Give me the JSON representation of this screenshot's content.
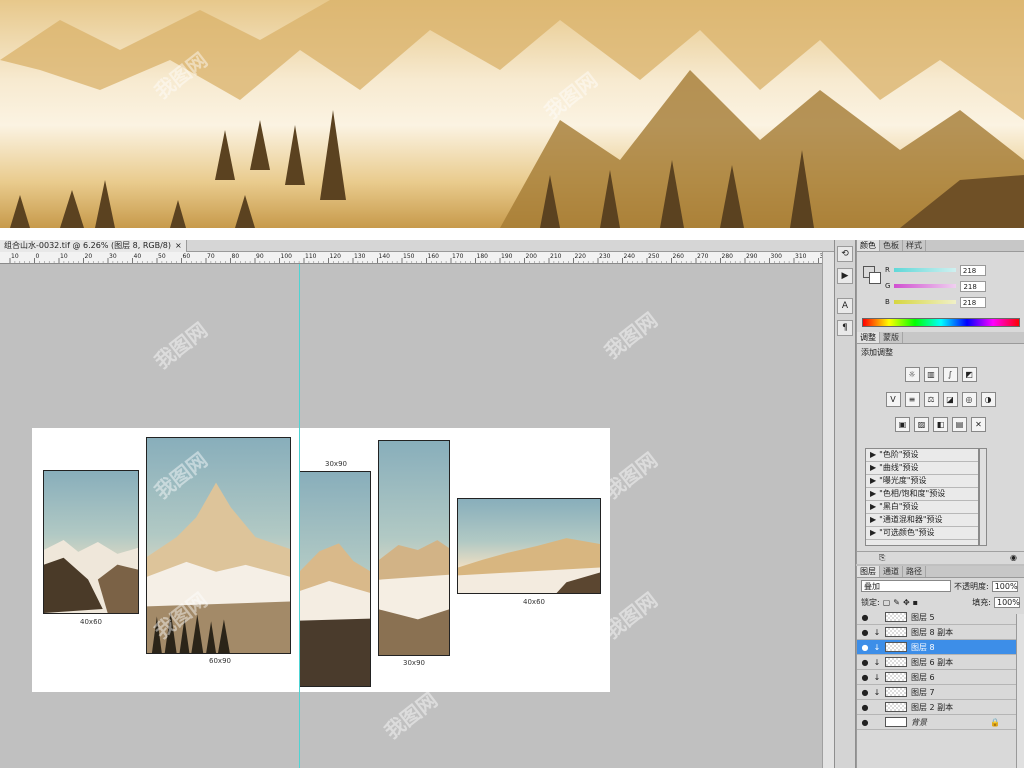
{
  "document": {
    "tab_title": "组合山水-0032.tif @ 6.26% (图层 8, RGB/8)",
    "close_glyph": "×"
  },
  "ruler": {
    "ticks": [
      "10",
      "0",
      "10",
      "20",
      "30",
      "40",
      "50",
      "60",
      "70",
      "80",
      "90",
      "100",
      "110",
      "120",
      "130",
      "140",
      "150",
      "160",
      "170",
      "180",
      "190",
      "200",
      "210",
      "220",
      "230",
      "240",
      "250",
      "260",
      "270",
      "280",
      "290",
      "300",
      "310",
      "320"
    ]
  },
  "artboard": {
    "labels": {
      "p1": "40x60",
      "p2": "60x90",
      "p3": "30x90",
      "p4": "30x90",
      "p5": "40x60"
    }
  },
  "color_panel": {
    "tabs": [
      "颜色",
      "色板",
      "样式"
    ],
    "channels": [
      {
        "name": "R",
        "value": "218",
        "color": "#2fb8b8"
      },
      {
        "name": "G",
        "value": "218",
        "color": "#d03fd0"
      },
      {
        "name": "B",
        "value": "218",
        "color": "#d2d23a"
      }
    ]
  },
  "adjustments": {
    "tabs": [
      "调整",
      "蒙版"
    ],
    "title": "添加调整",
    "presets": [
      "\"色阶\"预设",
      "\"曲线\"预设",
      "\"曝光度\"预设",
      "\"色相/饱和度\"预设",
      "\"黑白\"预设",
      "\"通道混和器\"预设",
      "\"可选颜色\"预设"
    ]
  },
  "layers_panel": {
    "tabs": [
      "图层",
      "通道",
      "路径"
    ],
    "blend_mode": "叠加",
    "opacity_label": "不透明度:",
    "opacity_value": "100%",
    "lock_label": "锁定:",
    "fill_label": "填充:",
    "fill_value": "100%",
    "layers": [
      {
        "name": "图层 5",
        "clipped": false,
        "selected": false,
        "locked": false
      },
      {
        "name": "图层 8 副本",
        "clipped": true,
        "selected": false,
        "locked": false
      },
      {
        "name": "图层 8",
        "clipped": true,
        "selected": true,
        "locked": false
      },
      {
        "name": "图层 6 副本",
        "clipped": true,
        "selected": false,
        "locked": false
      },
      {
        "name": "图层 6",
        "clipped": true,
        "selected": false,
        "locked": false
      },
      {
        "name": "图层 7",
        "clipped": true,
        "selected": false,
        "locked": false
      },
      {
        "name": "图层 2 副本",
        "clipped": false,
        "selected": false,
        "locked": false
      },
      {
        "name": "背景",
        "clipped": false,
        "selected": false,
        "locked": true
      }
    ]
  },
  "watermark": "我图网"
}
